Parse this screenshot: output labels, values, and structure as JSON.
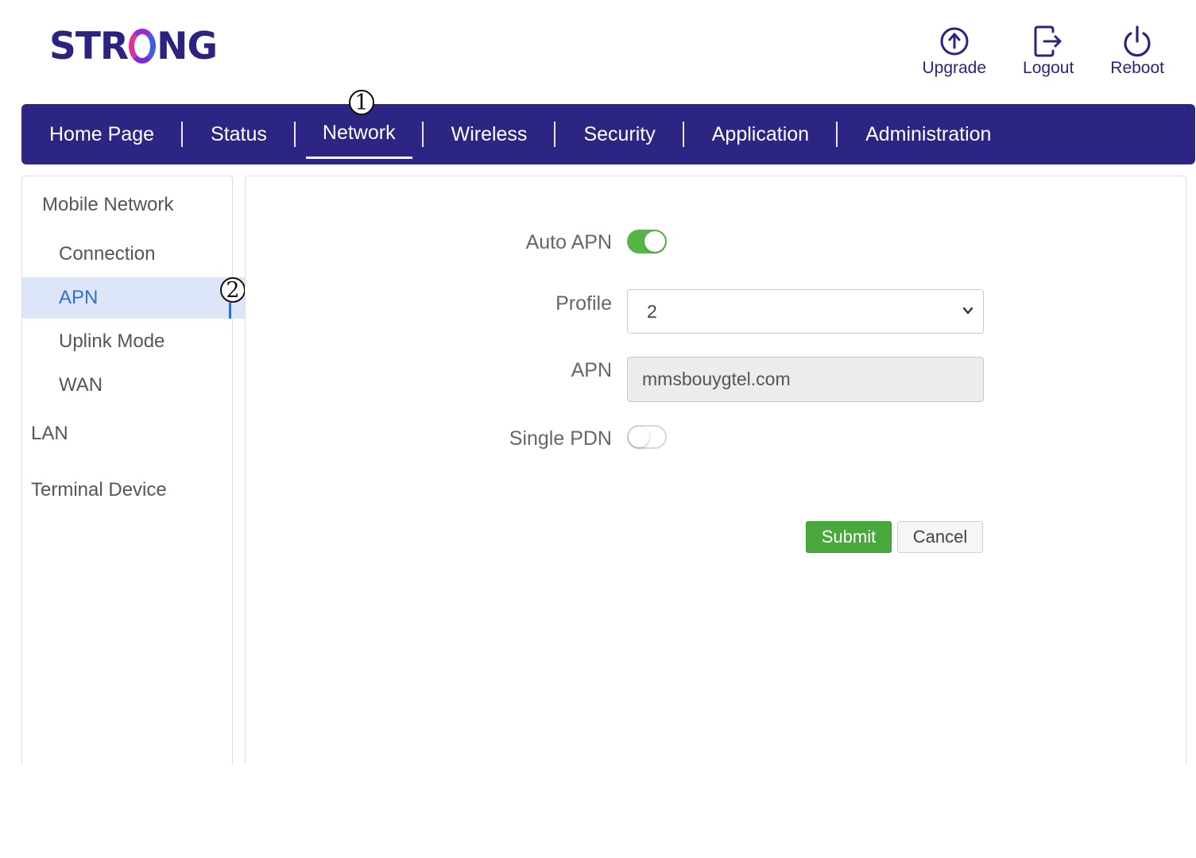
{
  "brand": {
    "logo_text_left": "STR",
    "logo_text_right": "NG"
  },
  "header_actions": [
    {
      "label": "Upgrade",
      "icon": "upload-circle-icon"
    },
    {
      "label": "Logout",
      "icon": "logout-icon"
    },
    {
      "label": "Reboot",
      "icon": "power-icon"
    }
  ],
  "nav": {
    "items": [
      "Home Page",
      "Status",
      "Network",
      "Wireless",
      "Security",
      "Application",
      "Administration"
    ],
    "active": "Network"
  },
  "markers": {
    "m1": "1",
    "m2": "2"
  },
  "sidebar": {
    "section_mobile": "Mobile Network",
    "sub_items": [
      "Connection",
      "APN",
      "Uplink Mode",
      "WAN"
    ],
    "active": "APN",
    "lan": "LAN",
    "terminal": "Terminal Device"
  },
  "form": {
    "auto_apn_label": "Auto APN",
    "auto_apn_on": true,
    "profile_label": "Profile",
    "profile_value": "2",
    "apn_label": "APN",
    "apn_value": "mmsbouygtel.com",
    "single_pdn_label": "Single PDN",
    "single_pdn_on": false
  },
  "buttons": {
    "submit": "Submit",
    "cancel": "Cancel"
  },
  "colors": {
    "nav_bg": "#2d2583",
    "accent_blue": "#2f6fcf",
    "toggle_on": "#56b545",
    "submit_green": "#48a83c"
  }
}
